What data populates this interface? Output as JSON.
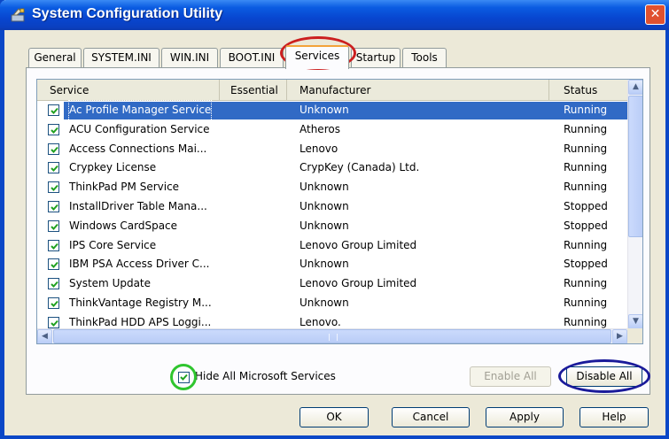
{
  "window": {
    "title": "System Configuration Utility"
  },
  "titlebar": {
    "close_glyph": "✕"
  },
  "tabs": [
    {
      "label": "General"
    },
    {
      "label": "SYSTEM.INI"
    },
    {
      "label": "WIN.INI"
    },
    {
      "label": "BOOT.INI"
    },
    {
      "label": "Services",
      "active": true
    },
    {
      "label": "Startup"
    },
    {
      "label": "Tools"
    }
  ],
  "list": {
    "columns": [
      "Service",
      "Essential",
      "Manufacturer",
      "Status"
    ],
    "rows": [
      {
        "checked": true,
        "service": "Ac Profile Manager Service",
        "essential": "",
        "manufacturer": "Unknown",
        "status": "Running",
        "selected": true
      },
      {
        "checked": true,
        "service": "ACU Configuration Service",
        "essential": "",
        "manufacturer": "Atheros",
        "status": "Running"
      },
      {
        "checked": true,
        "service": "Access Connections Mai...",
        "essential": "",
        "manufacturer": "Lenovo",
        "status": "Running"
      },
      {
        "checked": true,
        "service": "Crypkey License",
        "essential": "",
        "manufacturer": "CrypKey (Canada) Ltd.",
        "status": "Running"
      },
      {
        "checked": true,
        "service": "ThinkPad PM Service",
        "essential": "",
        "manufacturer": "Unknown",
        "status": "Running"
      },
      {
        "checked": true,
        "service": "InstallDriver Table Mana...",
        "essential": "",
        "manufacturer": "Unknown",
        "status": "Stopped"
      },
      {
        "checked": true,
        "service": "Windows CardSpace",
        "essential": "",
        "manufacturer": "Unknown",
        "status": "Stopped"
      },
      {
        "checked": true,
        "service": "IPS Core Service",
        "essential": "",
        "manufacturer": "Lenovo Group Limited",
        "status": "Running"
      },
      {
        "checked": true,
        "service": "IBM PSA Access Driver C...",
        "essential": "",
        "manufacturer": "Unknown",
        "status": "Stopped"
      },
      {
        "checked": true,
        "service": "System Update",
        "essential": "",
        "manufacturer": "Lenovo Group Limited",
        "status": "Running"
      },
      {
        "checked": true,
        "service": "ThinkVantage Registry M...",
        "essential": "",
        "manufacturer": "Unknown",
        "status": "Running"
      },
      {
        "checked": true,
        "service": "ThinkPad HDD APS Loggi...",
        "essential": "",
        "manufacturer": "Lenovo.",
        "status": "Running"
      }
    ]
  },
  "hide_ms": {
    "label": "Hide All Microsoft Services",
    "checked": true
  },
  "buttons": {
    "enable_all": "Enable All",
    "disable_all": "Disable All",
    "ok": "OK",
    "cancel": "Cancel",
    "apply": "Apply",
    "help": "Help"
  },
  "scroll": {
    "up": "▲",
    "down": "▼",
    "left": "◀",
    "right": "▶"
  },
  "colors": {
    "accent": "#0a47c7",
    "selection": "#316ac5",
    "annotation_red": "#cc1f1f",
    "annotation_green": "#2ec52e",
    "annotation_blue": "#1a1a9a"
  },
  "icons": {
    "app": "app-icon",
    "checkmark": "checkmark-icon"
  }
}
